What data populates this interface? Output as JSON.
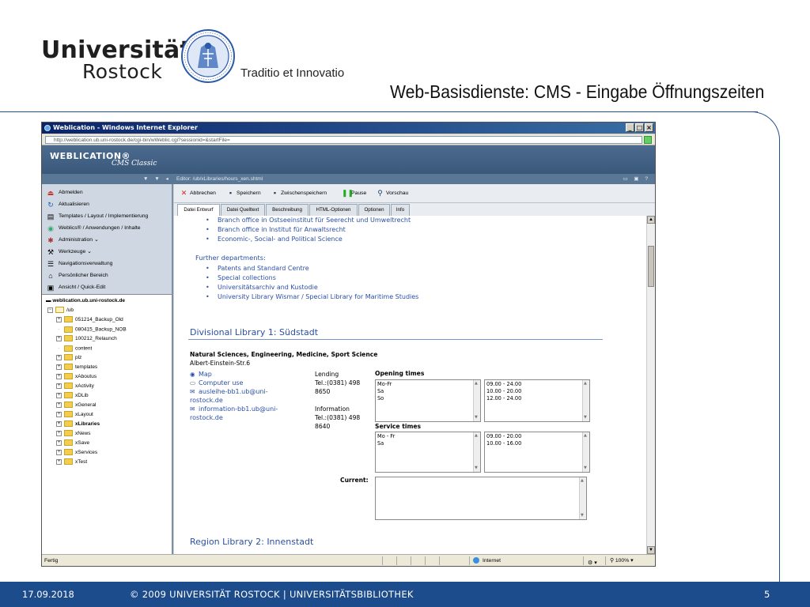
{
  "slide": {
    "logo_line1": "Universität",
    "logo_line2": "Rostock",
    "motto": "Traditio et Innovatio",
    "title": "Web-Basisdienste: CMS - Eingabe Öffnungszeiten"
  },
  "footer": {
    "date": "17.09.2018",
    "copyright": "© 2009 UNIVERSITÄT ROSTOCK | UNIVERSITÄTSBIBLIOTHEK",
    "page": "5"
  },
  "browser": {
    "title": "Weblication - Windows Internet Explorer",
    "url": "http://weblication.ub.uni-rostock.de/cgi-bin/wWeblic.cgi?sessionid=&startFile=",
    "status_left": "Fertig",
    "status_zone": "Internet",
    "zoom": "100%"
  },
  "app": {
    "brand": "WEBLICATION®",
    "brand_sub": "CMS Classic",
    "editor_path": "Editor: /ub/xLibraries/hours_xen.shtml"
  },
  "menu": [
    {
      "label": "Abmelden",
      "icon": "logout-icon"
    },
    {
      "label": "Aktualisieren",
      "icon": "refresh-icon"
    },
    {
      "label": "Templates / Layout / Implementierung",
      "icon": "template-icon"
    },
    {
      "label": "Weblics® / Anwendungen / Inhalte",
      "icon": "apps-icon"
    },
    {
      "label": "Administration",
      "icon": "admin-icon"
    },
    {
      "label": "Werkzeuge",
      "icon": "tools-icon"
    },
    {
      "label": "Navigationsverwaltung",
      "icon": "navigation-icon"
    },
    {
      "label": "Persönlicher Bereich",
      "icon": "home-icon"
    },
    {
      "label": "Ansicht / Quick-Edit",
      "icon": "view-icon"
    }
  ],
  "tree": {
    "server": "weblication.ub.uni-rostock.de",
    "root": "/ub",
    "items": [
      "051214_Backup_Old",
      "080415_Backup_NOB",
      "100212_Relaunch",
      "content",
      "plz",
      "templates",
      "xAboutus",
      "xActivity",
      "xDLib",
      "xGeneral",
      "xLayout",
      "xLibraries",
      "xNews",
      "xSave",
      "xServices",
      "xTest"
    ]
  },
  "toolbar": [
    "Abbrechen",
    "Speichern",
    "Zwischenspeichern",
    "Pause",
    "Vorschau"
  ],
  "tabs": [
    "Datei Entwurf",
    "Datei Quelltext",
    "Beschreibung",
    "HTML-Optionen",
    "Optionen",
    "Info"
  ],
  "content": {
    "list1": [
      "Branch office in Ostseeinstitut für Seerecht und Umweltrecht",
      "Branch office in Institut für Anwaltsrecht",
      "Economic-, Social- and Political Science"
    ],
    "further": "Further departments:",
    "list2": [
      "Patents and Standard Centre",
      "Special collections",
      "Universitätsarchiv and Kustodie",
      "University Library Wismar / Special Library for Maritime Studies"
    ],
    "library1_title": "Divisional Library 1: Südstadt",
    "library1_subject": "Natural Sciences, Engineering, Medicine, Sport Science",
    "library1_address": "Albert-Einstein-Str.6",
    "links": [
      "Map",
      "Computer use",
      "ausleihe-bb1.ub@uni-",
      "rostock.de",
      "information-bb1.ub@uni-",
      "rostock.de"
    ],
    "lending_label": "Lending",
    "lending_tel1": "Tel.:(0381) 498",
    "lending_tel2": "8650",
    "info_label": "Information",
    "info_tel1": "Tel.:(0381) 498",
    "info_tel2": "8640",
    "opening_label": "Opening times",
    "opening_days": "Mo-Fr\nSa\nSo",
    "opening_hours": "09.00 - 24.00\n10.00 - 20.00\n12.00 - 24.00",
    "service_label": "Service times",
    "service_days": "Mo - Fr\nSa",
    "service_hours": "09.00 - 20.00\n10.00 - 16.00",
    "current_label": "Current:",
    "library2_title": "Region Library 2: Innenstadt"
  }
}
